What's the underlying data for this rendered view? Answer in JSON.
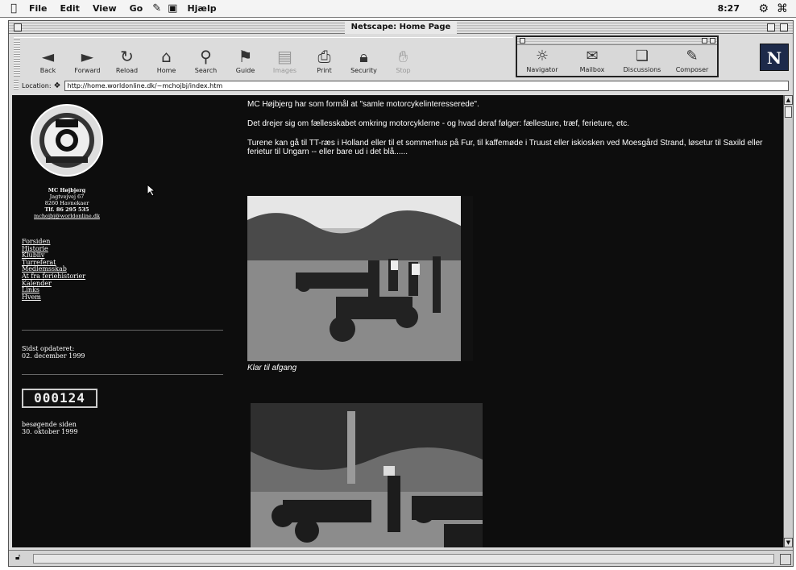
{
  "menubar": {
    "items": [
      "File",
      "Edit",
      "View",
      "Go",
      "Hjælp"
    ],
    "clock": "8:27"
  },
  "window": {
    "title": "Netscape: Home Page"
  },
  "toolbar": {
    "buttons": [
      {
        "label": "Back",
        "icon": "back-icon"
      },
      {
        "label": "Forward",
        "icon": "forward-icon"
      },
      {
        "label": "Reload",
        "icon": "reload-icon"
      },
      {
        "label": "Home",
        "icon": "home-icon"
      },
      {
        "label": "Search",
        "icon": "search-icon"
      },
      {
        "label": "Guide",
        "icon": "guide-icon"
      },
      {
        "label": "Images",
        "icon": "images-icon"
      },
      {
        "label": "Print",
        "icon": "print-icon"
      },
      {
        "label": "Security",
        "icon": "security-icon"
      },
      {
        "label": "Stop",
        "icon": "stop-icon"
      }
    ]
  },
  "components": {
    "buttons": [
      {
        "label": "Navigator",
        "icon": "navigator-icon"
      },
      {
        "label": "Mailbox",
        "icon": "mailbox-icon"
      },
      {
        "label": "Discussions",
        "icon": "discussions-icon"
      },
      {
        "label": "Composer",
        "icon": "composer-icon"
      }
    ]
  },
  "location": {
    "label": "Location:",
    "url": "http://home.worldonline.dk/~mchojbj/index.htm"
  },
  "page": {
    "club": {
      "name": "MC Højbjerg",
      "address": "Jagtvejvej 67",
      "city": "8260 Havnekaer",
      "phone": "Tlf. 86 295 535",
      "email": "mchojbj@worldonline.dk"
    },
    "nav": [
      "Forsiden",
      "Historie",
      "Klubliv",
      "Turreferat",
      "Medlemsskab",
      "At fra feriehistorier",
      "Kalender",
      "Links",
      "Hvem"
    ],
    "updated_label": "Sidst opdateret:",
    "updated_date": "02. december 1999",
    "counter": "000124",
    "since_label": "besøgende siden",
    "since_date": "30. oktober 1999",
    "intro": [
      "MC Højbjerg har som formål at \"samle motorcykelinteresserede\".",
      "Det drejer sig om fællesskabet omkring motorcyklerne - og hvad deraf følger: fællesture, træf, ferieture, etc.",
      "Turene kan gå til TT-ræs i Holland eller til et sommerhus på Fur, til kaffemøde i Truust eller iskiosken ved Moesgård Strand, løsetur til Saxild eller ferietur til Ungarn -- eller bare ud i det blå......"
    ],
    "caption1": "Klar til afgang"
  }
}
